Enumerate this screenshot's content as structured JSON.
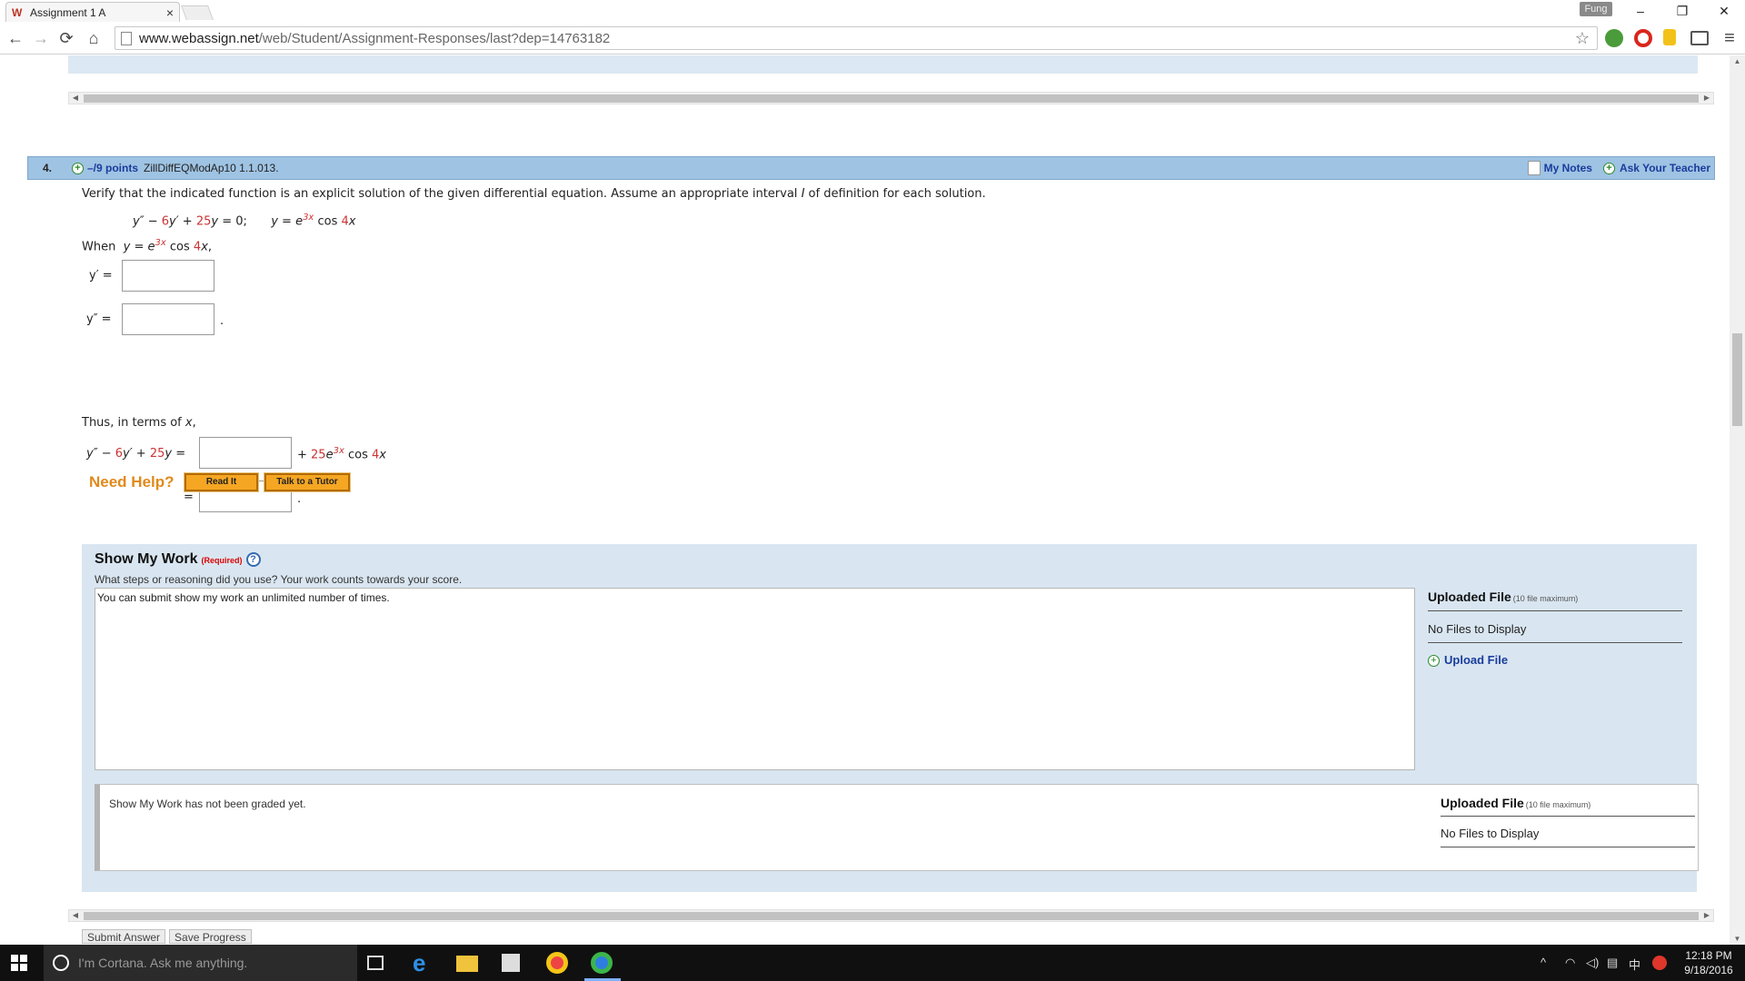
{
  "browser": {
    "tab_title": "Assignment 1 A",
    "tab_close": "×",
    "favicon_text": "W",
    "user_name": "Fung",
    "url_host": "www.webassign.net",
    "url_path": "/web/Student/Assignment-Responses/last?dep=14763182",
    "back": "←",
    "forward": "→",
    "reload": "⟳",
    "home": "⌂",
    "star": "☆",
    "menu": "≡",
    "minimize": "–",
    "restore": "❐",
    "close": "✕"
  },
  "question": {
    "number": "4.",
    "points": "–/9 points",
    "source": "ZillDiffEQModAp10 1.1.013.",
    "my_notes": "My Notes",
    "ask_teacher": "Ask Your Teacher",
    "prompt": "Verify that the indicated function is an explicit solution of the given differential equation. Assume an appropriate interval ",
    "prompt_var": "I",
    "prompt_end": " of definition for each solution.",
    "eq": {
      "y2": "y″",
      "minus": " − ",
      "six": "6",
      "y1": "y′",
      "plus": " + ",
      "tf": "25",
      "y": "y",
      "eq0": " = 0;",
      "y_sol": "y",
      "eq": " = ",
      "e": "e",
      "exp": "3x",
      "cos": " cos ",
      "four": "4",
      "x": "x"
    },
    "when": "When",
    "when_comma": ",",
    "yprime_label": "y′ =",
    "ydoubleprime_label": "y″ =",
    "period": ".",
    "thus": "Thus, in terms of ",
    "thus_x": "x",
    "thus_comma": ",",
    "combo": {
      "y2": "y″",
      "minus": " − ",
      "six": "6",
      "y1": "y′",
      "plus": " + ",
      "tf": "25",
      "y": "y",
      "eq": " ="
    },
    "term_plus": "+ ",
    "term_25": "25",
    "term_e": "e",
    "term_exp": "3x",
    "term_cos": " cos ",
    "term_4": "4",
    "term_x": "x",
    "equals": "=",
    "need_help": "Need Help?",
    "read_it": "Read It",
    "talk_tutor": "Talk to a Tutor"
  },
  "show_work": {
    "title": "Show My Work",
    "required": "(Required)",
    "help": "?",
    "description": "What steps or reasoning did you use? Your work counts towards your score.",
    "textarea_value": "You can submit show my work an unlimited number of times.",
    "uploaded_title": "Uploaded File",
    "uploaded_max": "(10 file maximum)",
    "no_files": "No Files to Display",
    "upload_link": "Upload File",
    "graded_text": "Show My Work has not been graded yet.",
    "graded_uploaded_title": "Uploaded File",
    "graded_uploaded_max": "(10 file maximum)",
    "graded_no_files": "No Files to Display"
  },
  "actions": {
    "submit": "Submit Answer",
    "save": "Save Progress"
  },
  "taskbar": {
    "cortana_placeholder": "I'm Cortana. Ask me anything.",
    "ime": "中",
    "time": "12:18 PM",
    "date": "9/18/2016"
  }
}
